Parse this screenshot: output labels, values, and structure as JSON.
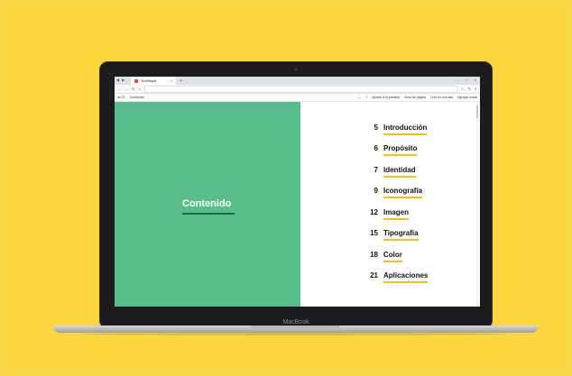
{
  "browser": {
    "tab_title": "TexBlkpdf",
    "tab_close": "×",
    "new_tab": "+",
    "window_controls": [
      "–",
      "□",
      "×"
    ],
    "left_icons": [
      "◀",
      "▶"
    ],
    "address": "",
    "nav_buttons": [
      "←",
      "→",
      "↻",
      "⌂"
    ],
    "addr_icons": [
      "☆",
      "✎",
      "⇪"
    ]
  },
  "pdf_toolbar": {
    "page_indicator": "de 21",
    "contents_label": "Contenido",
    "zoom_out": "—",
    "zoom_in": "+",
    "fit_label": "Ajustar a la pantalla",
    "page_view": "Vista de página",
    "read_aloud": "Leer en voz alta",
    "add_notes": "Agregar notas"
  },
  "document": {
    "left_title": "Contenido",
    "left_bg": "#59bd8b",
    "accent_underline": "#f2c21b",
    "toc": [
      {
        "page": "5",
        "title": "Introducción"
      },
      {
        "page": "6",
        "title": "Propósito"
      },
      {
        "page": "7",
        "title": "Identidad"
      },
      {
        "page": "9",
        "title": "Iconografía"
      },
      {
        "page": "12",
        "title": "Imagen"
      },
      {
        "page": "15",
        "title": "Tipografía"
      },
      {
        "page": "18",
        "title": "Color"
      },
      {
        "page": "21",
        "title": "Aplicaciones"
      }
    ]
  },
  "device": {
    "brand_label": "MacBook"
  }
}
